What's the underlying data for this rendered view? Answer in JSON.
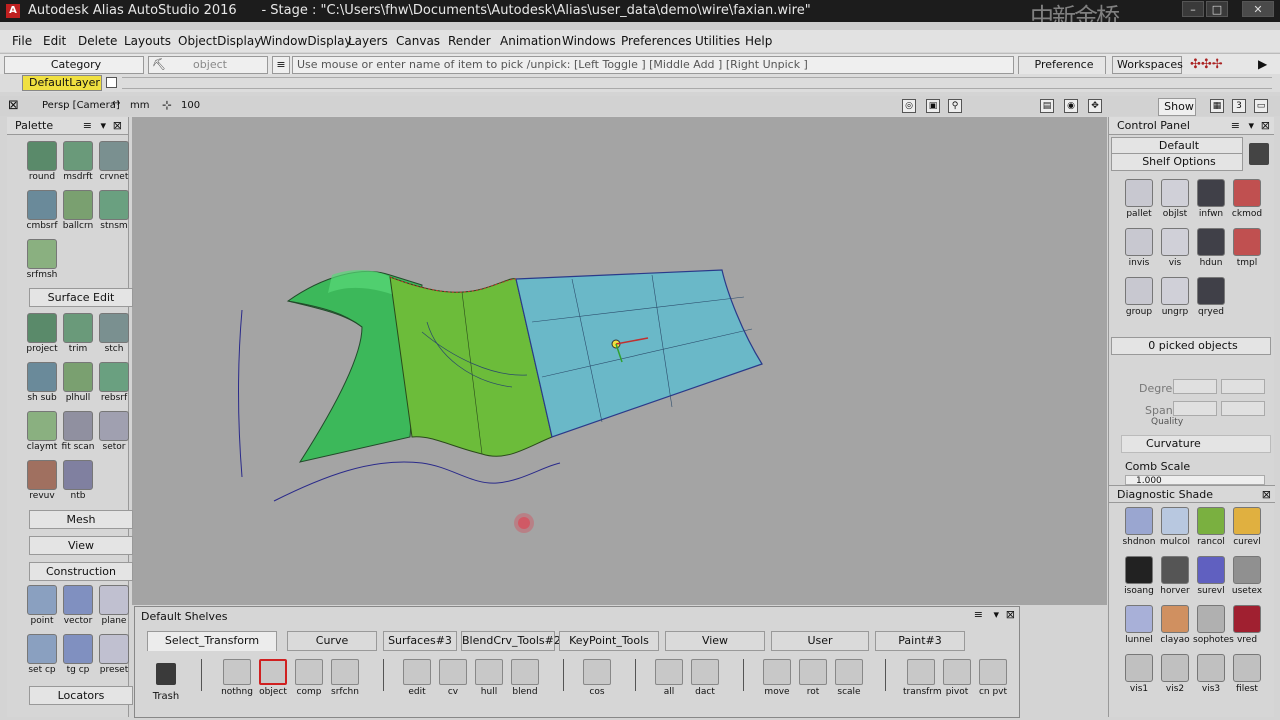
{
  "window": {
    "title": "Autodesk Alias AutoStudio 2016      - Stage : \"C:\\Users\\fhw\\Documents\\Autodesk\\Alias\\user_data\\demo\\wire\\faxian.wire\"",
    "watermark": "中新金桥",
    "min": "–",
    "max": "□",
    "close": "✕"
  },
  "menu": [
    "File",
    "Edit",
    "Delete",
    "Layouts",
    "ObjectDisplay",
    "WindowDisplay",
    "Layers",
    "Canvas",
    "Render",
    "Animation",
    "Windows",
    "Preferences",
    "Utilities",
    "Help"
  ],
  "toolbar": {
    "category": "Category",
    "object": "object",
    "prompt": "Use mouse or enter name of item to pick /unpick: [Left Toggle ] [Middle Add ] [Right Unpick ]",
    "preference_sets": "Preference Sets",
    "workspaces": "Workspaces"
  },
  "layers": {
    "default_layer": "DefaultLayer"
  },
  "viewport": {
    "camera": "Persp [Camera]",
    "units": "mm",
    "scale": "100",
    "show": "Show",
    "num": "3"
  },
  "palette": {
    "title": "Palette",
    "group1": [
      {
        "label": "round",
        "icon": "round-icon"
      },
      {
        "label": "msdrft",
        "icon": "msdrft-icon"
      },
      {
        "label": "crvnet",
        "icon": "crvnet-icon"
      },
      {
        "label": "cmbsrf",
        "icon": "cmbsrf-icon"
      },
      {
        "label": "ballcrn",
        "icon": "ballcrn-icon"
      },
      {
        "label": "stnsm",
        "icon": "stnsm-icon"
      },
      {
        "label": "srfmsh",
        "icon": "srfmsh-icon"
      }
    ],
    "surface_edit": "Surface Edit",
    "group2": [
      {
        "label": "project",
        "icon": "project-icon"
      },
      {
        "label": "trim",
        "icon": "trim-icon"
      },
      {
        "label": "stch",
        "icon": "stch-icon"
      },
      {
        "label": "sh sub",
        "icon": "sh-sub-icon"
      },
      {
        "label": "plhull",
        "icon": "plhull-icon"
      },
      {
        "label": "rebsrf",
        "icon": "rebsrf-icon"
      },
      {
        "label": "claymt",
        "icon": "claymt-icon"
      },
      {
        "label": "fit scan",
        "icon": "fit-scan-icon"
      },
      {
        "label": "setor",
        "icon": "setor-icon"
      },
      {
        "label": "revuv",
        "icon": "revuv-icon"
      },
      {
        "label": "ntb",
        "icon": "ntb-icon"
      }
    ],
    "mesh": "Mesh",
    "view": "View",
    "construction": "Construction",
    "group3": [
      {
        "label": "point",
        "icon": "point-icon"
      },
      {
        "label": "vector",
        "icon": "vector-icon"
      },
      {
        "label": "plane",
        "icon": "plane-icon"
      },
      {
        "label": "set cp",
        "icon": "set-cp-icon"
      },
      {
        "label": "tg cp",
        "icon": "tg-cp-icon"
      },
      {
        "label": "preset",
        "icon": "preset-icon"
      }
    ],
    "locators": "Locators"
  },
  "control_panel": {
    "title": "Control Panel",
    "preset": "Default",
    "shelf_options": "Shelf Options",
    "tools": [
      {
        "label": "pallet",
        "icon": "pallet-icon"
      },
      {
        "label": "objlst",
        "icon": "objlst-icon"
      },
      {
        "label": "infwn",
        "icon": "info-icon"
      },
      {
        "label": "ckmod",
        "icon": "ckmod-icon"
      },
      {
        "label": "invis",
        "icon": "invis-icon"
      },
      {
        "label": "vis",
        "icon": "vis-icon"
      },
      {
        "label": "hdun",
        "icon": "hdun-icon"
      },
      {
        "label": "tmpl",
        "icon": "tmpl-icon"
      },
      {
        "label": "group",
        "icon": "group-icon"
      },
      {
        "label": "ungrp",
        "icon": "ungrp-icon"
      },
      {
        "label": "qryed",
        "icon": "qryed-icon"
      }
    ],
    "picked": "0 picked objects",
    "degree": "Degree",
    "spans": "Spans",
    "quality": "Quality",
    "curvature": "Curvature",
    "comb_scale": "Comb Scale",
    "comb_value": "1.000"
  },
  "diagnostic": {
    "title": "Diagnostic Shade",
    "tools": [
      {
        "label": "shdnon",
        "icon": "shdnon-icon",
        "color": "#9aa6d0"
      },
      {
        "label": "mulcol",
        "icon": "mulcol-icon",
        "color": "#b8c8e0"
      },
      {
        "label": "rancol",
        "icon": "rancol-icon",
        "color": "#7ab040"
      },
      {
        "label": "curevl",
        "icon": "curevl-icon",
        "color": "#e0b040"
      },
      {
        "label": "isoang",
        "icon": "isoang-icon",
        "color": "#222222"
      },
      {
        "label": "horver",
        "icon": "horver-icon",
        "color": "#555555"
      },
      {
        "label": "surevl",
        "icon": "surevl-icon",
        "color": "#6060c0"
      },
      {
        "label": "usetex",
        "icon": "usetex-icon",
        "color": "#909090"
      },
      {
        "label": "lunnel",
        "icon": "lunnel-icon",
        "color": "#a8b0d8"
      },
      {
        "label": "clayao",
        "icon": "clayao-icon",
        "color": "#d09060"
      },
      {
        "label": "sophotes",
        "icon": "sophotes-icon",
        "color": "#b0b0b0"
      },
      {
        "label": "vred",
        "icon": "vred-icon",
        "color": "#a02030"
      },
      {
        "label": "vis1",
        "icon": "vis1-icon",
        "color": "#c0c0c0"
      },
      {
        "label": "vis2",
        "icon": "vis2-icon",
        "color": "#c0c0c0"
      },
      {
        "label": "vis3",
        "icon": "vis3-icon",
        "color": "#c0c0c0"
      },
      {
        "label": "filest",
        "icon": "filest-icon",
        "color": "#c0c0c0"
      }
    ]
  },
  "shelves": {
    "title": "Default Shelves",
    "tabs": [
      "Select_Transform",
      "Curve",
      "Surfaces#3",
      "BlendCrv_Tools#2",
      "KeyPoint_Tools",
      "View",
      "User",
      "Paint#3"
    ],
    "trash": "Trash",
    "tools": [
      {
        "label": "nothng",
        "icon": "nothing-icon"
      },
      {
        "label": "object",
        "icon": "object-pick-icon"
      },
      {
        "label": "comp",
        "icon": "component-icon"
      },
      {
        "label": "srfchn",
        "icon": "srfchn-icon"
      },
      {
        "label": "edit",
        "icon": "edit-pick-icon"
      },
      {
        "label": "cv",
        "icon": "cv-pick-icon"
      },
      {
        "label": "hull",
        "icon": "hull-pick-icon"
      },
      {
        "label": "blend",
        "icon": "blend-pick-icon"
      },
      {
        "label": "cos",
        "icon": "cos-icon"
      },
      {
        "label": "all",
        "icon": "all-icon"
      },
      {
        "label": "dact",
        "icon": "dact-icon"
      },
      {
        "label": "move",
        "icon": "move-icon"
      },
      {
        "label": "rot",
        "icon": "rotate-icon"
      },
      {
        "label": "scale",
        "icon": "scale-icon"
      },
      {
        "label": "transfrm",
        "icon": "transform-icon"
      },
      {
        "label": "pivot",
        "icon": "pivot-icon"
      },
      {
        "label": "cn pvt",
        "icon": "cn-pvt-icon"
      }
    ]
  }
}
